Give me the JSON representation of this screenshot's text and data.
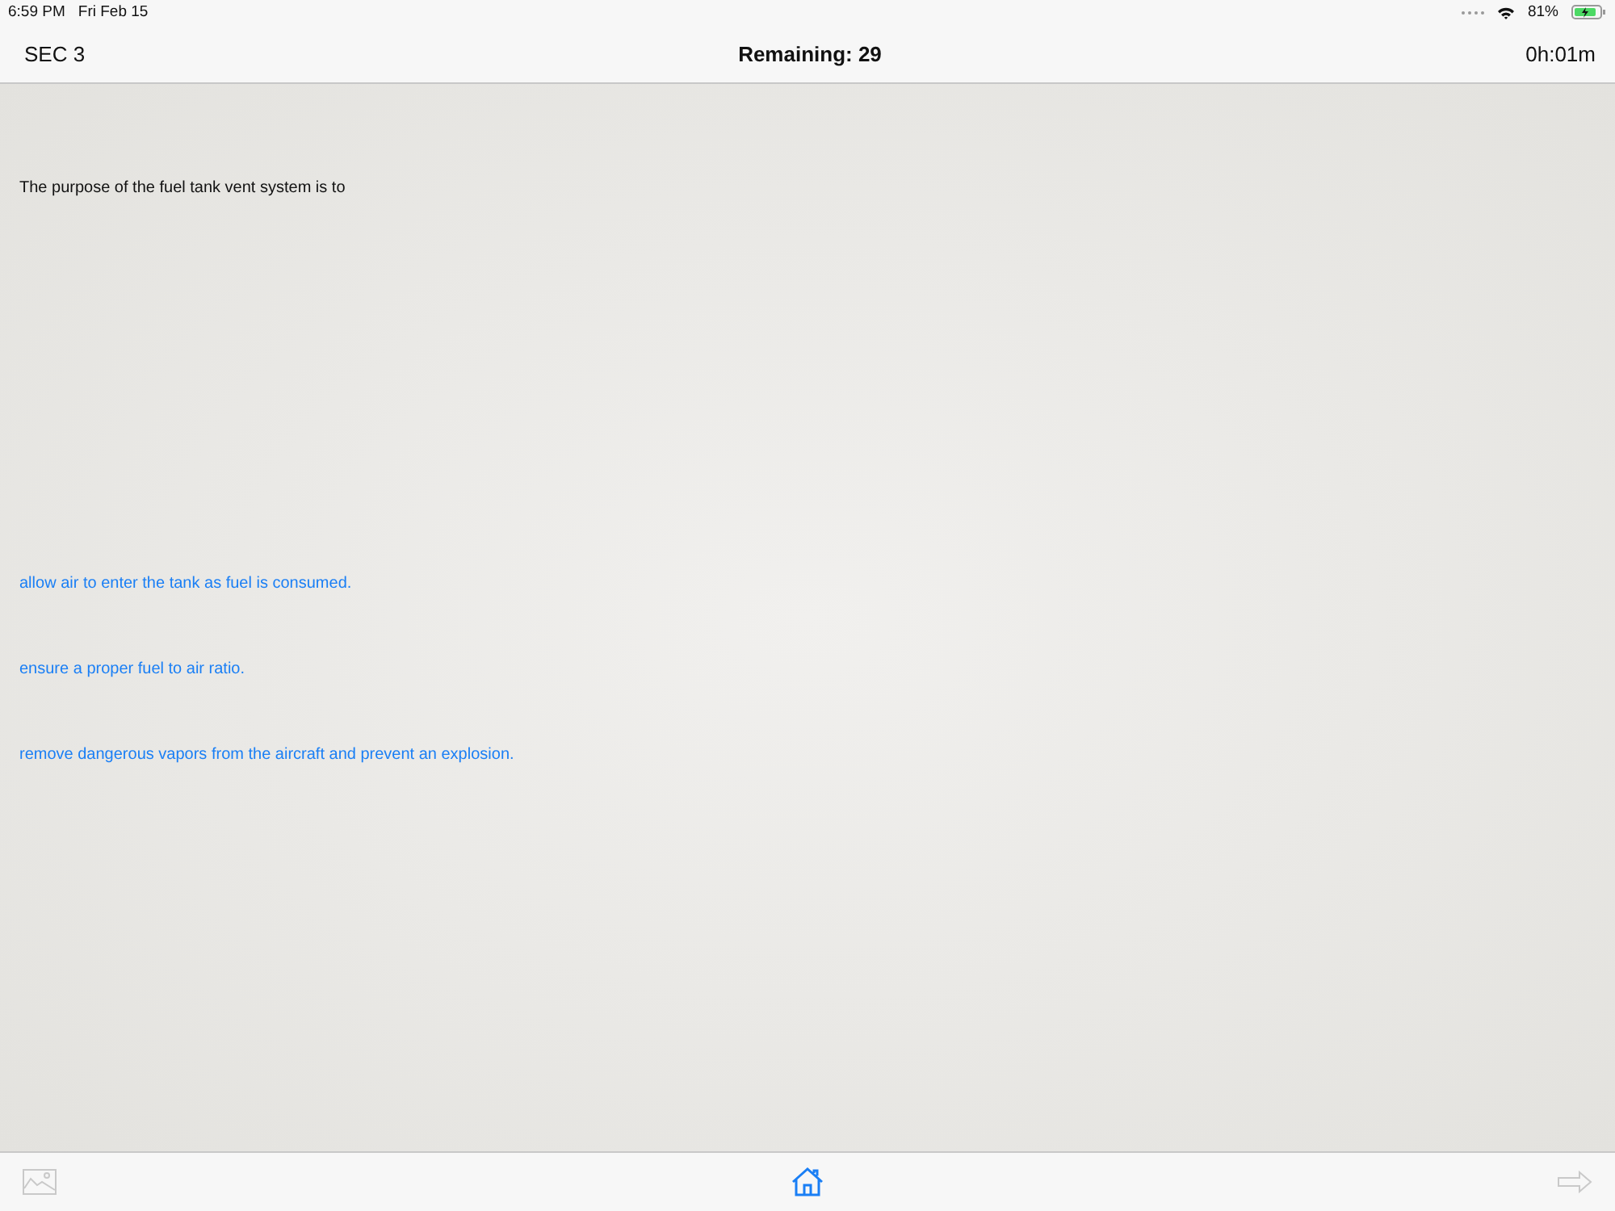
{
  "status_bar": {
    "time": "6:59 PM",
    "date": "Fri Feb 15",
    "battery": "81%"
  },
  "nav_bar": {
    "section": "SEC 3",
    "title": "Remaining: 29",
    "timer": "0h:01m"
  },
  "question": "The purpose of the fuel tank vent system is to",
  "answers": [
    {
      "text": "allow air to enter the tank as fuel is consumed."
    },
    {
      "text": "ensure a proper fuel to air ratio."
    },
    {
      "text": "remove dangerous vapors from the aircraft and prevent an explosion."
    }
  ],
  "toolbar": {
    "image_button": {
      "disabled": true
    },
    "next_button": {
      "disabled": true
    }
  }
}
